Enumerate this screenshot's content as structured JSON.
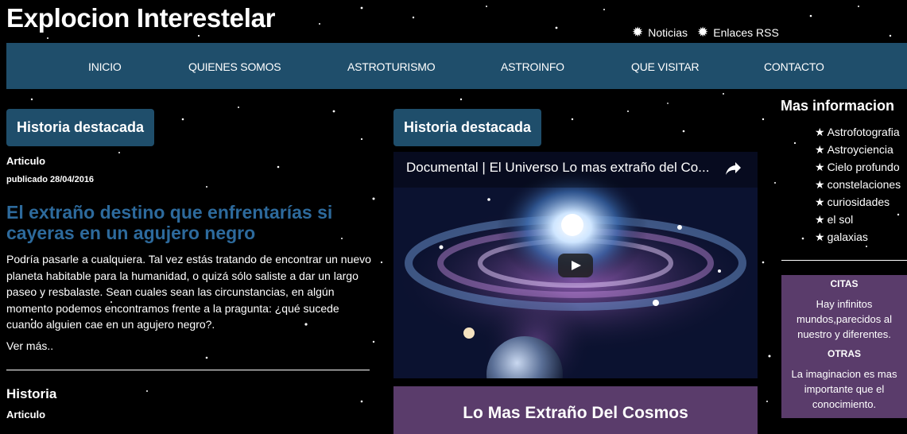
{
  "site": {
    "title": "Explocion Interestelar",
    "top_links": [
      {
        "label": "Noticias",
        "icon": "gear-icon"
      },
      {
        "label": "Enlaces RSS",
        "icon": "gear-icon"
      }
    ]
  },
  "nav": {
    "items": [
      "INICIO",
      "QUIENES SOMOS",
      "ASTROTURISMO",
      "ASTROINFO",
      "QUE VISITAR",
      "CONTACTO"
    ]
  },
  "left": {
    "featured_tag": "Historia destacada",
    "category": "Articulo",
    "date": "publicado 28/04/2016",
    "title": "El extraño destino que enfrentarías si cayeras en un agujero negro",
    "body": "Podría pasarle a cualquiera. Tal vez estás tratando de encontrar un nuevo planeta habitable para la humanidad, o quizá sólo saliste a dar un largo paseo y resbalaste. Sean cuales sean las circunstancias, en algún momento podemos encontramos frente a la pragunta: ¿qué sucede cuando alguien cae en un agujero negro?.",
    "read_more": "Ver más..",
    "next_section": "Historia",
    "next_category": "Articulo"
  },
  "middle": {
    "featured_tag": "Historia destacada",
    "video_title": "Documental | El Universo Lo mas extraño del Co...",
    "box_title": "Lo Mas Extraño Del Cosmos"
  },
  "right": {
    "title": "Mas informacion",
    "links": [
      "Astrofotografia",
      "Astroyciencia",
      "Cielo profundo",
      "constelaciones",
      "curiosidades",
      "el sol",
      "galaxias"
    ],
    "quotes": {
      "heading1": "CITAS",
      "quote1": "Hay infinitos mundos,parecidos al nuestro y diferentes.",
      "heading2": "OTRAS",
      "quote2": "La imaginacion es mas importante que el conocimiento."
    }
  },
  "colors": {
    "background": "#000000",
    "nav": "#1f4e6b",
    "link_title": "#2d6a9c",
    "purple": "#5a3c6b"
  }
}
